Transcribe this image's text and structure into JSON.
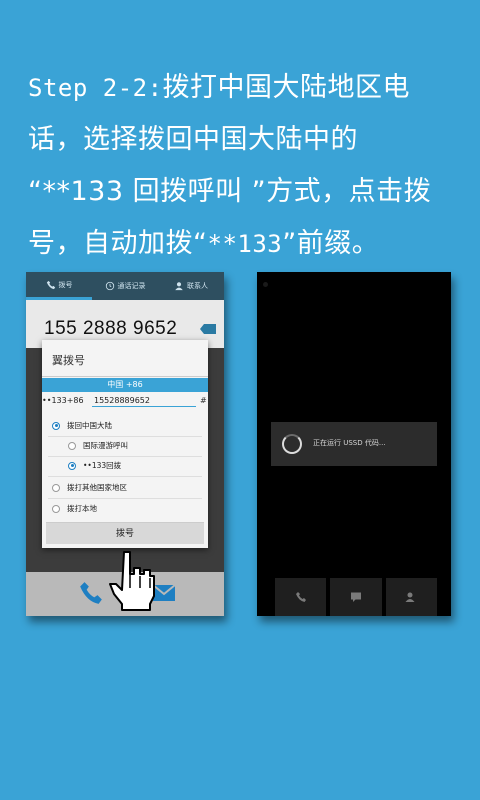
{
  "instruction": {
    "step_label": "Step 2-2:",
    "line1_rest": "拨打中国大陆地区电",
    "line2": "话，选择拨回中国大陆中的",
    "line3_quote": "“**133 回拨呼叫 ”",
    "line3_rest": "方式，点击拨",
    "line4_pre": "号，自动加拨“",
    "line4_code": "**133",
    "line4_post": "”前缀。"
  },
  "left_phone": {
    "tabs": [
      {
        "label": "拨号",
        "icon": "phone-icon"
      },
      {
        "label": "通话记录",
        "icon": "clock-icon"
      },
      {
        "label": "联系人",
        "icon": "contact-icon"
      }
    ],
    "dialed_number": "155 2888 9652",
    "modal": {
      "title": "翼拨号",
      "country": "中国 +86",
      "prefix": "••133+86",
      "number_value": "15528889652",
      "hash": "#",
      "options": [
        {
          "label": "拨回中国大陆",
          "selected": true
        },
        {
          "label": "国际漫游呼叫",
          "selected": false
        },
        {
          "label": "••133回拨",
          "selected": true
        },
        {
          "label": "拨打其他国家地区",
          "selected": false
        },
        {
          "label": "拨打本地",
          "selected": false
        }
      ],
      "dial_button": "拨号"
    }
  },
  "right_phone": {
    "ussd_text": "正在运行 USSD 代码..."
  },
  "colors": {
    "background": "#3aa3d6",
    "accent": "#3aa3d6",
    "tabbar": "#2e4f60"
  }
}
